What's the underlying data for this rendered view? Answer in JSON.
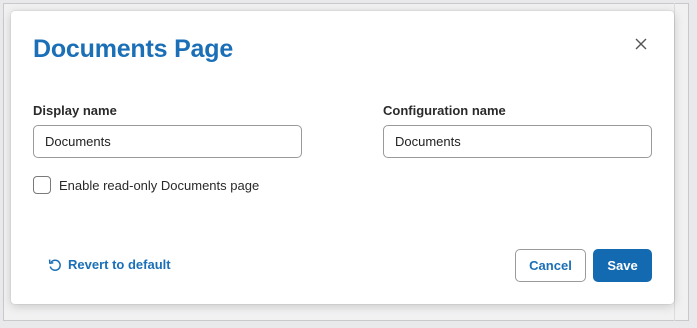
{
  "dialog": {
    "title": "Documents Page",
    "close_icon": "close-icon"
  },
  "display_name": {
    "label": "Display name",
    "value": "Documents"
  },
  "configuration_name": {
    "label": "Configuration name",
    "value": "Documents"
  },
  "read_only": {
    "label": "Enable read-only Documents page",
    "checked": false
  },
  "footer": {
    "revert_label": "Revert to default",
    "revert_icon": "revert-icon",
    "cancel_label": "Cancel",
    "save_label": "Save"
  },
  "colors": {
    "accent": "#1b6fb6",
    "primary_button": "#136ab0"
  }
}
